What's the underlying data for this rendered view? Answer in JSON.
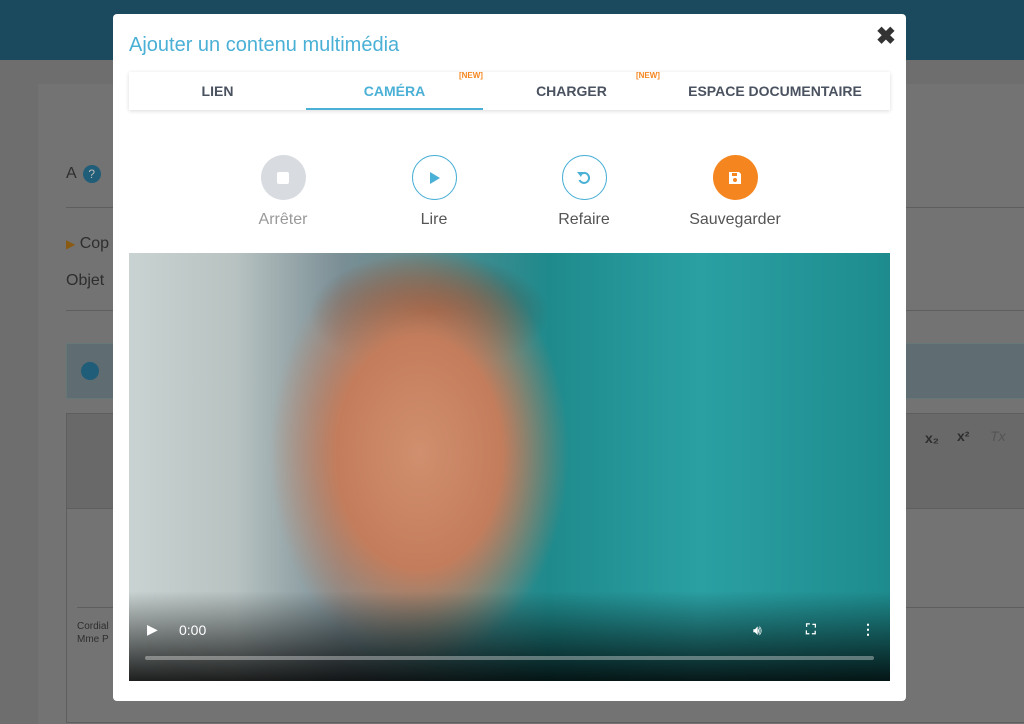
{
  "background": {
    "to_label": "A",
    "help_icon": "?",
    "copy_label": "Cop",
    "subject_label": "Objet",
    "signature_line1": "Cordial",
    "signature_line2": "Mme P",
    "toolbar": {
      "subscript": "x₂",
      "superscript": "x²",
      "clear_format": "Tx"
    }
  },
  "modal": {
    "title": "Ajouter un contenu multimédia",
    "close_icon": "close-icon",
    "tabs": [
      {
        "label": "LIEN",
        "badge": ""
      },
      {
        "label": "CAMÉRA",
        "badge": "[NEW]",
        "active": true
      },
      {
        "label": "CHARGER",
        "badge": "[NEW]"
      },
      {
        "label": "ESPACE DOCUMENTAIRE",
        "badge": ""
      }
    ],
    "controls": [
      {
        "label": "Arrêter",
        "icon": "stop-icon",
        "disabled": true
      },
      {
        "label": "Lire",
        "icon": "play-icon"
      },
      {
        "label": "Refaire",
        "icon": "redo-icon"
      },
      {
        "label": "Sauvegarder",
        "icon": "save-icon"
      }
    ],
    "video": {
      "time": "0:00",
      "progress": 0
    }
  },
  "colors": {
    "accent": "#4bb0d6",
    "save": "#f5861f",
    "new_badge": "#f5861f",
    "disabled": "#d8dbe0"
  }
}
